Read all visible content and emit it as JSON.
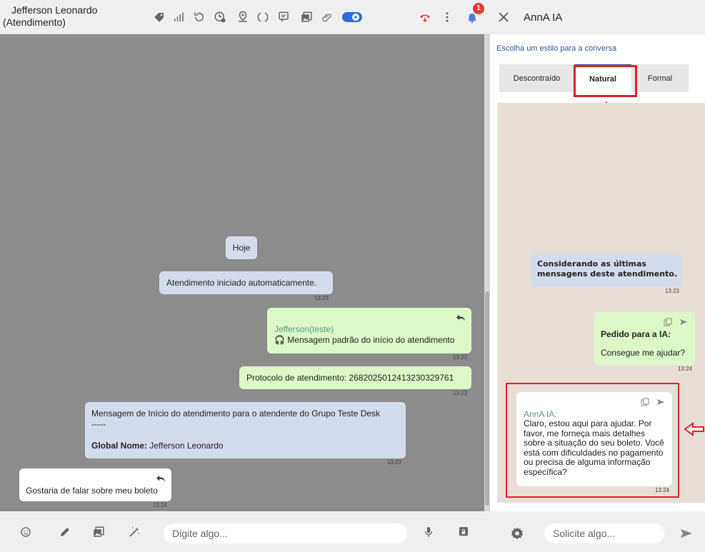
{
  "header": {
    "contact_name": "Jefferson Leonardo",
    "contact_status": "(Atendimento)",
    "notification_count": "1",
    "icons": [
      "tag-icon",
      "signal-icon",
      "history-icon",
      "schedule-icon",
      "location-pin-icon",
      "transfer-icon",
      "message-icon",
      "gallery-icon",
      "attachment-icon",
      "toggle-switch-icon",
      "hangup-icon",
      "more-icon",
      "notification-bell-icon"
    ]
  },
  "messages": {
    "date_divider": "Hoje",
    "system_start": {
      "text": "Atendimento iniciado automaticamente.",
      "time": "13:23"
    },
    "agent_default": {
      "author": "Jefferson(teste)",
      "text": "Mensagem padrão do início do atendimento",
      "time": "13:23"
    },
    "protocol": {
      "text": "Protocolo de atendimento: 2682025012413230329761",
      "time": "13:23"
    },
    "start_info": {
      "line1": "Mensagem de Início do atendimento para o atendente  do Grupo Teste Desk",
      "separator": "-----",
      "global_label": "Global Nome:",
      "global_value": " Jefferson Leonardo",
      "time": "13:23"
    },
    "customer": {
      "text": "Gostaria de falar sobre meu boleto",
      "time": "13:24"
    }
  },
  "composer": {
    "placeholder": "Digite algo..."
  },
  "ai_panel": {
    "title": "AnnA IA",
    "style_label": "Escolha um estilo para a conversa",
    "tabs": [
      {
        "label": "Descontraído",
        "active": false
      },
      {
        "label": "Natural",
        "active": true
      },
      {
        "label": "Formal",
        "active": false
      }
    ],
    "context_msg": {
      "text": "Considerando as últimas mensagens deste atendimento.",
      "time": "13:23"
    },
    "request_msg": {
      "label": "Pedido para a IA:",
      "text": "Consegue me ajudar?",
      "time": "13:24"
    },
    "reply_msg": {
      "author": "AnnA IA:",
      "text": "Claro, estou aqui para ajudar. Por favor, me forneça mais detalhes sobre a situação do seu boleto. Você está com dificuldades no pagamento ou precisa de alguma informação específica?",
      "time": "13:24"
    },
    "input_placeholder": "Solicite algo..."
  },
  "colors": {
    "chat_bg": "#8c8c8c",
    "system_bubble": "#d4dcec",
    "outgoing_bubble": "#dcf8c6",
    "ai_chat_bg": "#e7ded6",
    "accent": "#2d5a9b",
    "highlight": "#e0202a"
  }
}
